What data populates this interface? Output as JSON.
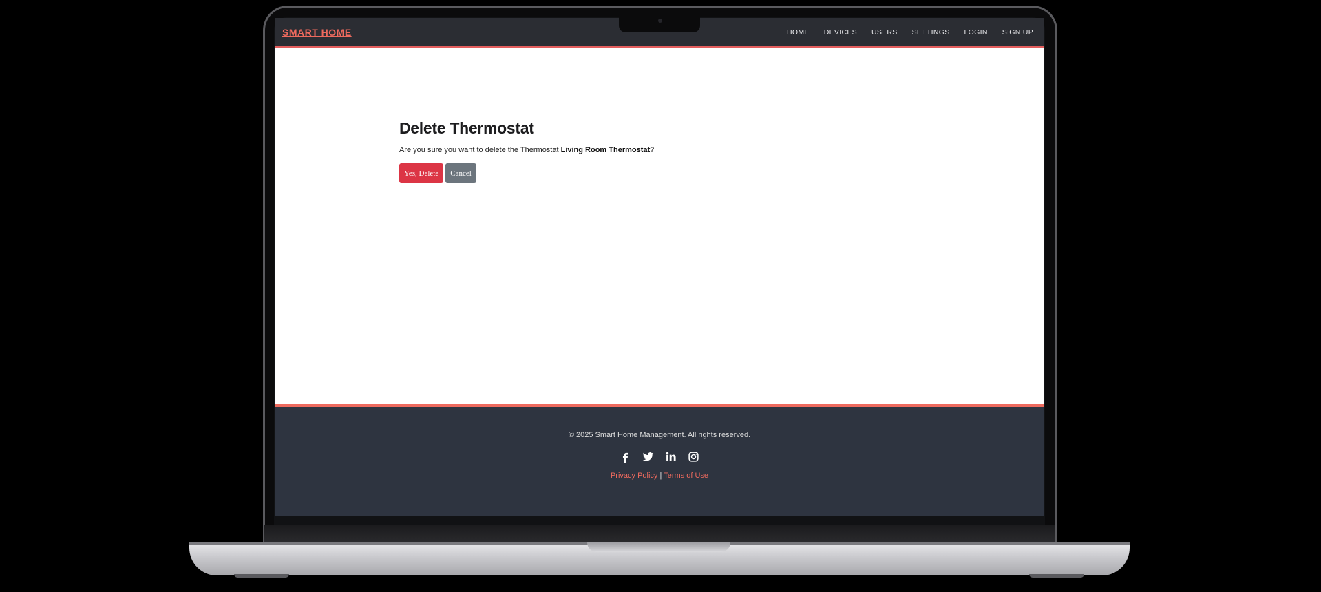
{
  "nav": {
    "brand": "SMART HOME",
    "links": [
      "HOME",
      "DEVICES",
      "USERS",
      "SETTINGS",
      "LOGIN",
      "SIGN UP"
    ]
  },
  "main": {
    "title": "Delete Thermostat",
    "confirm_prefix": "Are you sure you want to delete the Thermostat ",
    "device_name": "Living Room Thermostat",
    "confirm_suffix": "?",
    "delete_label": "Yes, Delete",
    "cancel_label": "Cancel"
  },
  "footer": {
    "copyright": "© 2025 Smart Home Management. All rights reserved.",
    "social_icons": [
      "facebook-icon",
      "twitter-icon",
      "linkedin-icon",
      "instagram-icon"
    ],
    "privacy_label": "Privacy Policy",
    "separator": " | ",
    "terms_label": "Terms of Use"
  },
  "colors": {
    "accent": "#ee6a5e",
    "navbar_bg": "#2b2d33",
    "footer_bg": "#2e3440",
    "danger": "#dc3545",
    "secondary": "#6c757d"
  }
}
